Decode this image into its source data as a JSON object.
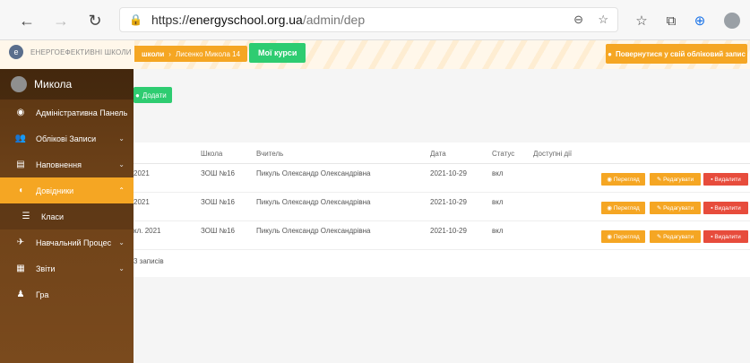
{
  "browser": {
    "url_prefix": "https://",
    "url_host": "energyschool.org.ua",
    "url_path": "/admin/dep"
  },
  "header": {
    "brand": "ЕНЕРГОЕФЕКТИВНІ ШКОЛИ",
    "crumb_first": "школи",
    "crumb_sep": "›",
    "crumb_second": "Лисенко Микола 14",
    "my_courses": "Мої курси",
    "return_label": "Повернутися у свій обліковий запис"
  },
  "sidebar": {
    "user_name": "Микола",
    "items": [
      {
        "label": "Адміністративна Панель",
        "icon": "dashboard-icon",
        "glyph": "◉",
        "chevron": ""
      },
      {
        "label": "Облікові Записи",
        "icon": "users-icon",
        "glyph": "👥",
        "chevron": "⌄"
      },
      {
        "label": "Наповнення",
        "icon": "file-icon",
        "glyph": "▤",
        "chevron": "⌄"
      },
      {
        "label": "Довідники",
        "icon": "book-icon",
        "glyph": "◖",
        "chevron": "⌃"
      },
      {
        "label": "Класи",
        "icon": "list-icon",
        "glyph": "☰",
        "chevron": ""
      },
      {
        "label": "Навчальний Процес",
        "icon": "rocket-icon",
        "glyph": "✈",
        "chevron": "⌄"
      },
      {
        "label": "Звіти",
        "icon": "report-icon",
        "glyph": "▦",
        "chevron": "⌄"
      },
      {
        "label": "Гра",
        "icon": "people-icon",
        "glyph": "♟",
        "chevron": ""
      }
    ]
  },
  "content": {
    "add_label": "Додати",
    "columns": [
      "Школа",
      "Вчитель",
      "Дата",
      "Статус",
      "Доступні дії"
    ],
    "rows": [
      {
        "name": "2021",
        "school": "ЗОШ №16",
        "teacher": "Пикуль Олександр Олександрівна",
        "date": "2021-10-29",
        "status": "вкл"
      },
      {
        "name": "2021",
        "school": "ЗОШ №16",
        "teacher": "Пикуль Олександр Олександрівна",
        "date": "2021-10-29",
        "status": "вкл"
      },
      {
        "name": "кл. 2021",
        "school": "ЗОШ №16",
        "teacher": "Пикуль Олександр Олександрівна",
        "date": "2021-10-29",
        "status": "вкл"
      }
    ],
    "view_label": "Перегляд",
    "edit_label": "Редагувати",
    "delete_label": "Видалити",
    "footer": "3 записів"
  }
}
